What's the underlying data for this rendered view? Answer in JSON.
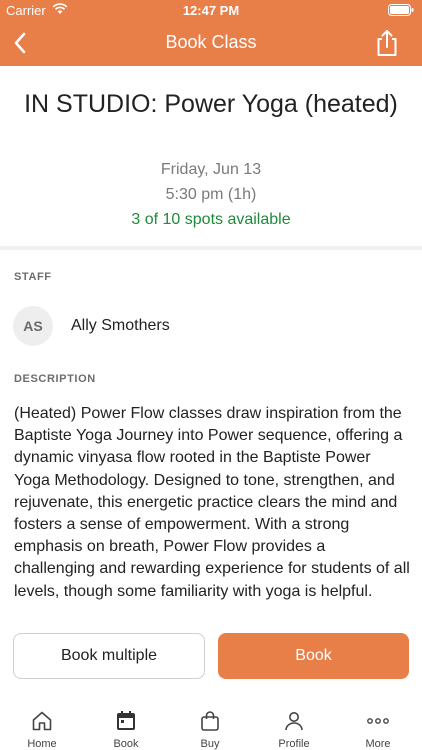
{
  "status_bar": {
    "carrier": "Carrier",
    "time": "12:47 PM"
  },
  "nav": {
    "title": "Book Class",
    "back_icon": "chevron-left-icon",
    "share_icon": "share-icon"
  },
  "class_info": {
    "title": "IN STUDIO: Power Yoga (heated)",
    "date": "Friday, Jun 13",
    "time": "5:30 pm (1h)",
    "spots": "3 of 10 spots available"
  },
  "staff": {
    "section_label": "STAFF",
    "initials": "AS",
    "name": "Ally Smothers"
  },
  "description": {
    "section_label": "DESCRIPTION",
    "text": "(Heated) Power Flow classes draw inspiration from the Baptiste Yoga Journey into Power sequence, offering a dynamic vinyasa flow rooted in the Baptiste Power Yoga Methodology. Designed to tone, strengthen, and rejuvenate, this energetic practice clears the mind and fosters a sense of empowerment. With a strong emphasis on breath, Power Flow provides a challenging and rewarding experience for students of all levels, though some familiarity with yoga is helpful."
  },
  "actions": {
    "book_multiple": "Book multiple",
    "book": "Book"
  },
  "tabs": [
    {
      "label": "Home",
      "icon": "home-icon"
    },
    {
      "label": "Book",
      "icon": "calendar-icon"
    },
    {
      "label": "Buy",
      "icon": "shopping-bag-icon"
    },
    {
      "label": "Profile",
      "icon": "person-icon"
    },
    {
      "label": "More",
      "icon": "more-dots-icon"
    }
  ],
  "colors": {
    "brand": "#e87e48",
    "available": "#1f8a3b",
    "muted": "#7a7a7a"
  }
}
